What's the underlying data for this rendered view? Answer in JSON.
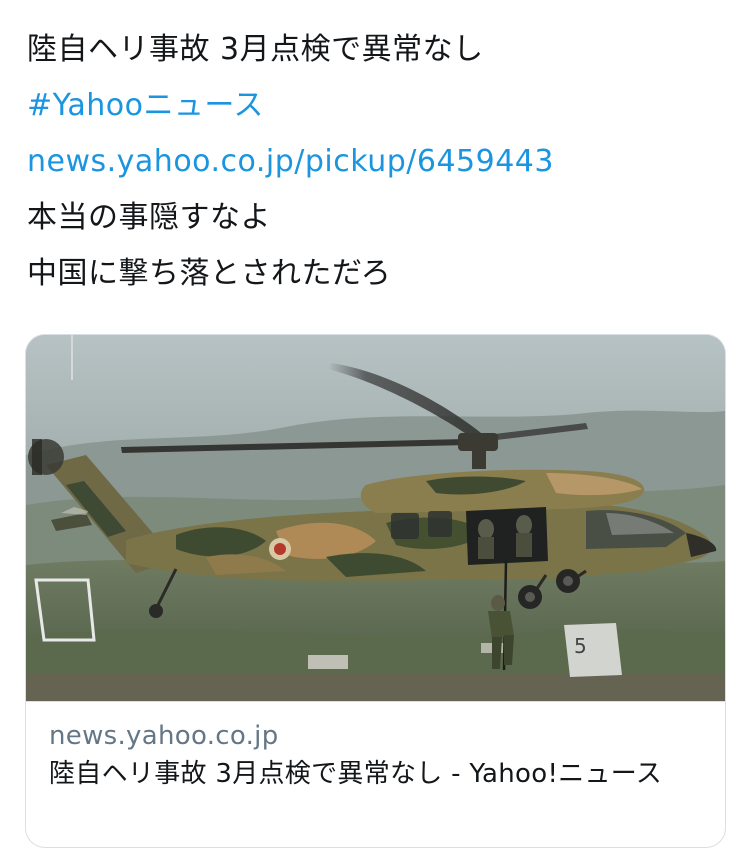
{
  "tweet": {
    "line1": "陸自ヘリ事故 3月点検で異常なし",
    "hashtag": "#Yahooニュース",
    "url": "news.yahoo.co.jp/pickup/6459443",
    "line4": "本当の事隠すなよ",
    "line5": "中国に撃ち落とされただろ"
  },
  "card": {
    "domain": "news.yahoo.co.jp",
    "title": "陸自ヘリ事故 3月点検で異常なし - Yahoo!ニュース",
    "image_alt": "military-helicopter-photo"
  },
  "colors": {
    "link": "#1b95e0",
    "text": "#14171a",
    "muted": "#657786",
    "border": "#d9dfe4"
  }
}
